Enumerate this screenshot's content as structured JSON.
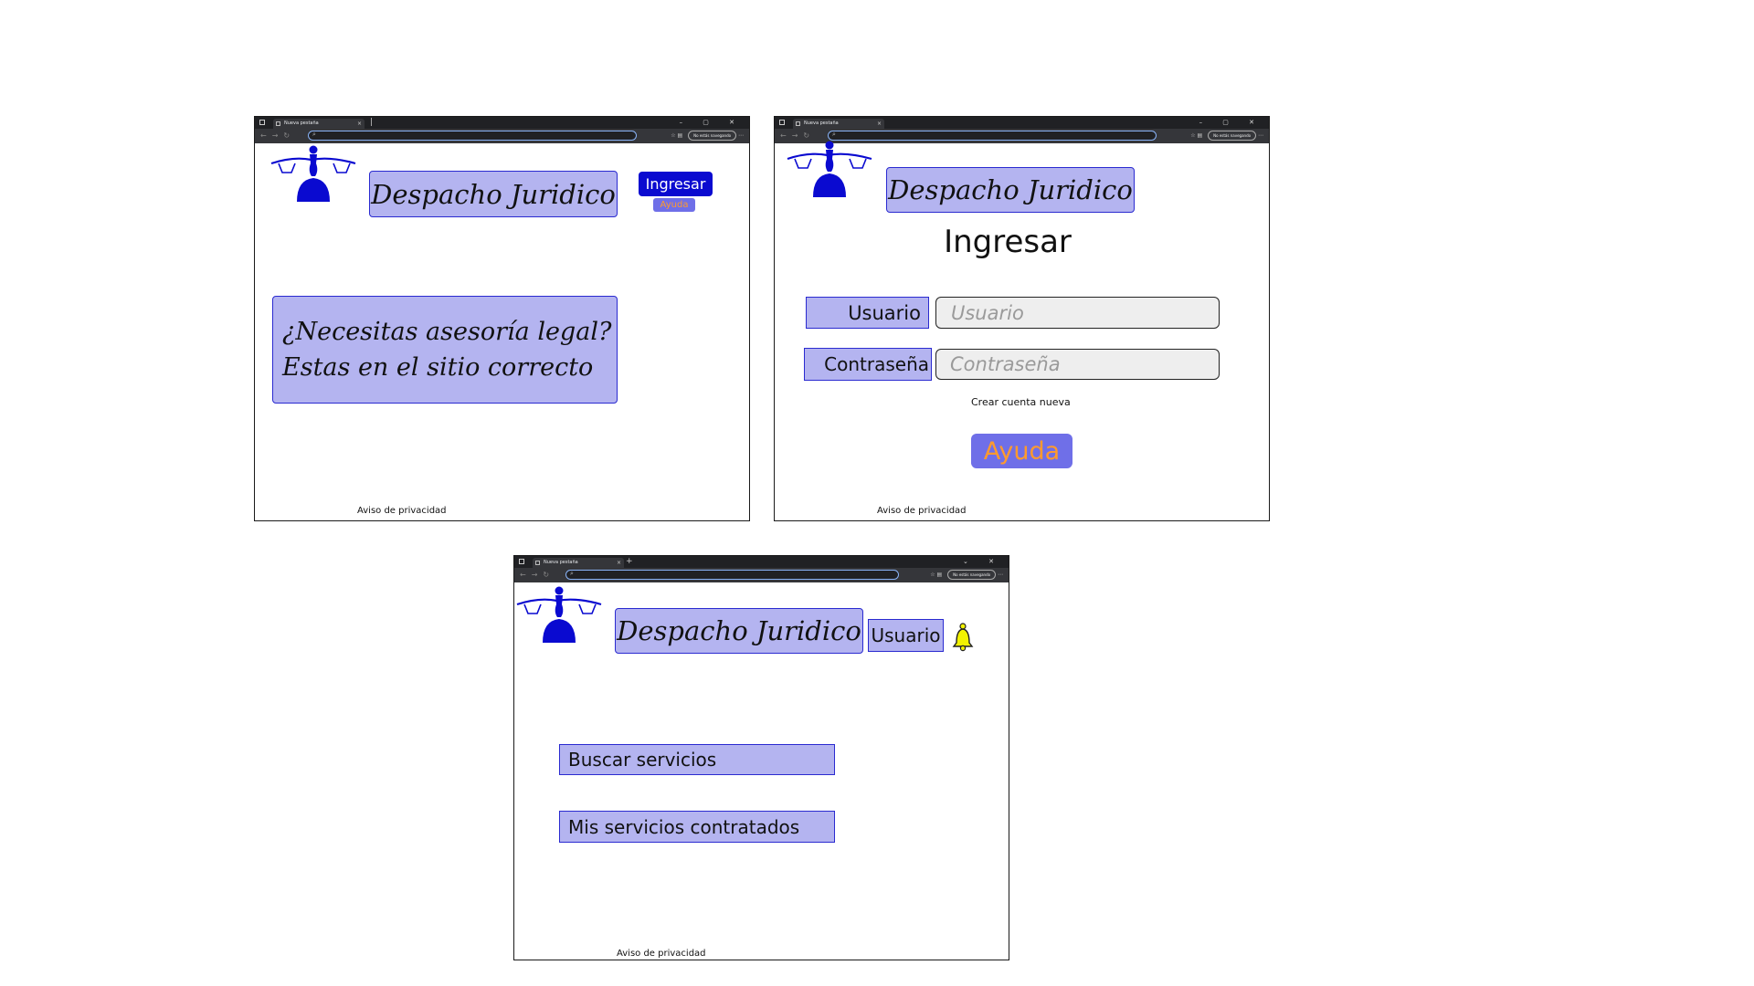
{
  "browser": {
    "tab_title_1": "Nueva pestaña",
    "tab_title_2": "Nueva pestaña",
    "tab_title_3": "Nueva pestaña",
    "profile_label": "No estás navegando",
    "window_controls": "– ▢ ✕"
  },
  "brand": {
    "title": "Despacho Juridico",
    "primary_color": "#0a0ad0",
    "box_color": "#b4b4f0",
    "help_text_color": "#ff9a2e"
  },
  "landing": {
    "login_button": "Ingresar",
    "help_button": "Ayuda",
    "hero_line_1": "¿Necesitas asesoría legal?",
    "hero_line_2": "Estas en el sitio correcto",
    "footer": "Aviso de privacidad"
  },
  "login": {
    "heading": "Ingresar",
    "user_label": "Usuario",
    "user_placeholder": "Usuario",
    "password_label": "Contraseña",
    "password_placeholder": "Contraseña",
    "create_account": "Crear cuenta nueva",
    "help_button": "Ayuda",
    "footer": "Aviso de privacidad"
  },
  "dashboard": {
    "user_button": "Usuario",
    "notification_icon": "bell-icon",
    "menu": [
      "Buscar servicios",
      "Mis servicios contratados"
    ],
    "footer": "Aviso de privacidad"
  }
}
